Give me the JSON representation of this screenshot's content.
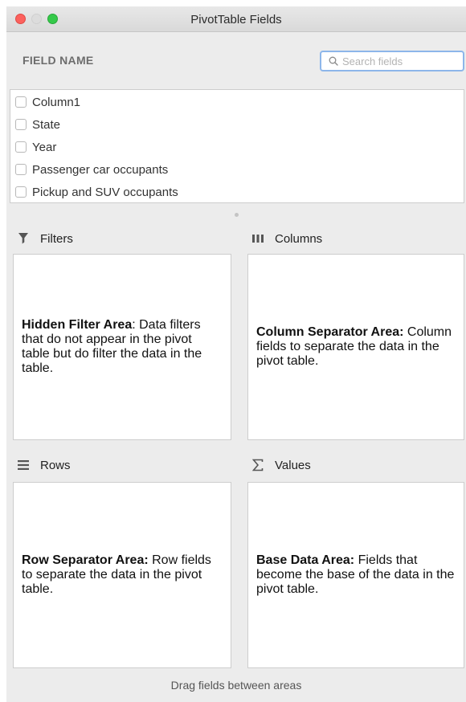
{
  "window": {
    "title": "PivotTable Fields"
  },
  "field_section": {
    "header": "FIELD NAME",
    "search_placeholder": "Search fields",
    "items": [
      {
        "label": "Column1",
        "checked": false
      },
      {
        "label": "State",
        "checked": false
      },
      {
        "label": "Year",
        "checked": false
      },
      {
        "label": "Passenger car occupants",
        "checked": false
      },
      {
        "label": "Pickup and SUV occupants",
        "checked": false
      }
    ]
  },
  "areas": {
    "filters": {
      "label": "Filters",
      "icon": "funnel-icon",
      "desc_bold": "Hidden Filter Area",
      "desc_rest": ": Data filters that do not appear in the pivot table but do filter the data in the table."
    },
    "columns": {
      "label": "Columns",
      "icon": "columns-icon",
      "desc_bold": "Column Separator Area:",
      "desc_rest": " Column fields to separate the data in the pivot table."
    },
    "rows": {
      "label": "Rows",
      "icon": "rows-icon",
      "desc_bold": "Row Separator Area:",
      "desc_rest": " Row fields to separate the data in the pivot table."
    },
    "values": {
      "label": "Values",
      "icon": "sigma-icon",
      "desc_bold": "Base Data Area:",
      "desc_rest": " Fields that become the base of the data in the pivot table."
    }
  },
  "footer": "Drag fields between areas"
}
